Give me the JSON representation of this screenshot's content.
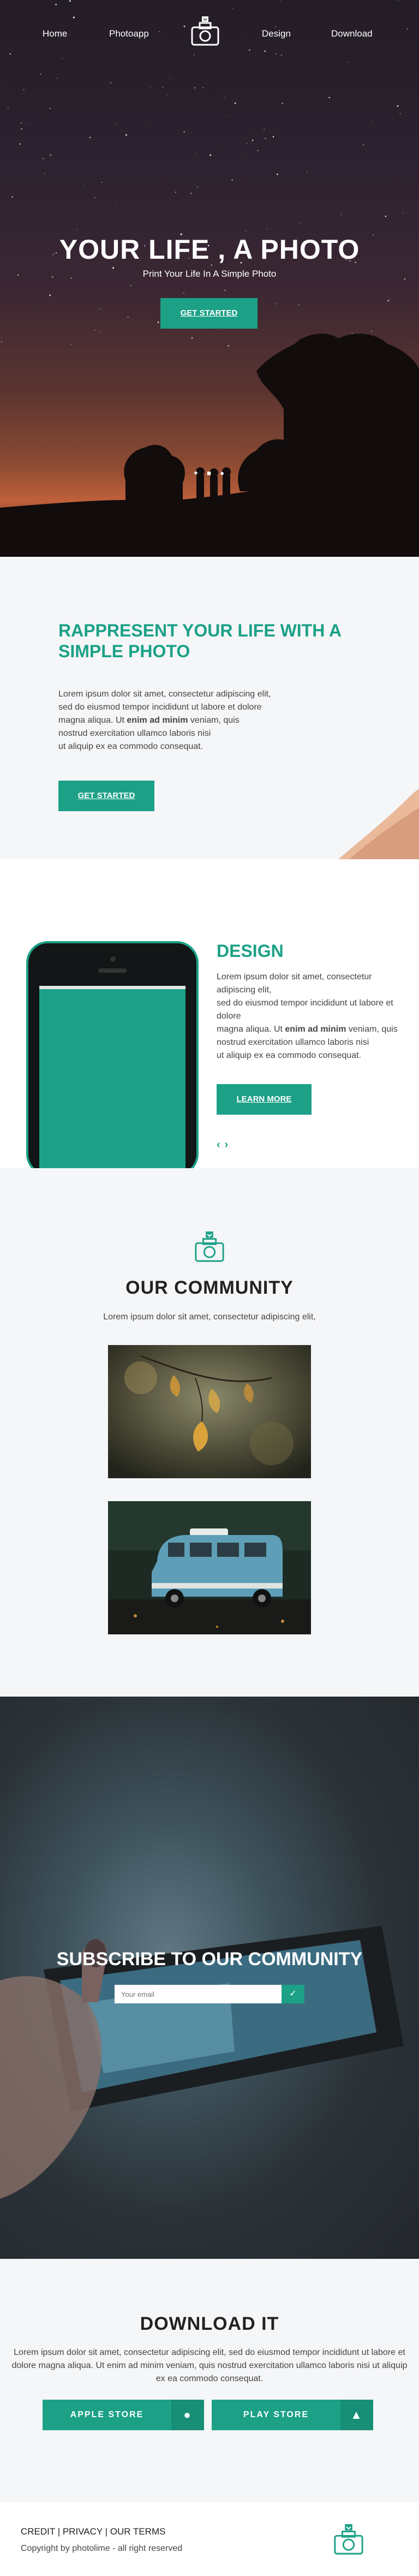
{
  "nav": {
    "links": [
      "Home",
      "Photoapp",
      "Design",
      "Download"
    ],
    "logo_icon": "camera-heart-logo"
  },
  "hero": {
    "title": "YOUR LIFE , A PHOTO",
    "subtitle": "Print Your Life In A Simple Photo",
    "cta": "GET STARTED",
    "social_icons": [
      "twitter-icon",
      "linkedin-icon",
      "pinterest-icon"
    ]
  },
  "rappresent": {
    "title": "RAPPRESENT YOUR LIFE WITH A SIMPLE PHOTO",
    "body_lines": [
      "Lorem ipsum dolor sit amet, consectetur adipiscing elit,",
      "sed do eiusmod tempor incididunt ut labore et dolore",
      "magna aliqua. Ut ",
      "enim ad minim",
      " veniam, quis",
      "nostrud exercitation ullamco laboris nisi",
      "ut aliquip ex ea commodo consequat."
    ],
    "cta": "GET STARTED"
  },
  "design": {
    "title": "DESIGN",
    "body_lines": [
      "Lorem ipsum dolor sit amet, consectetur adipiscing elit,",
      "sed do eiusmod tempor incididunt ut labore et dolore",
      "magna aliqua. Ut ",
      "enim ad minim",
      " veniam, quis",
      "nostrud exercitation ullamco laboris nisi",
      "ut aliquip ex ea commodo consequat."
    ],
    "cta": "LEARN MORE",
    "prev_arrow": "‹",
    "next_arrow": "›"
  },
  "community": {
    "title": "OUR COMMUNITY",
    "subtitle": "Lorem ipsum dolor sit amet, consectetur adipiscing elit,"
  },
  "subscribe": {
    "title": "SUBSCRIBE TO OUR COMMUNITY",
    "placeholder": "Your email",
    "submit_icon": "check-icon"
  },
  "download": {
    "title": "DOWNLOAD IT",
    "body": "Lorem ipsum dolor sit amet, consectetur adipiscing elit, sed do eiusmod tempor incididunt ut labore et dolore magna aliqua. Ut enim ad minim veniam, quis nostrud exercitation ullamco laboris nisi ut aliquip ex ea commodo consequat.",
    "app_store": "APPLE STORE",
    "play_store": "PLAY STORE",
    "app_store_icon": "apple-icon",
    "play_store_icon": "android-icon"
  },
  "footer": {
    "links": "CREDIT | PRIVACY | OUR TERMS",
    "copyright": "Copyright by photolime - all right reserved"
  },
  "colors": {
    "accent": "#1ca187",
    "background_light": "#f5f6f8"
  }
}
